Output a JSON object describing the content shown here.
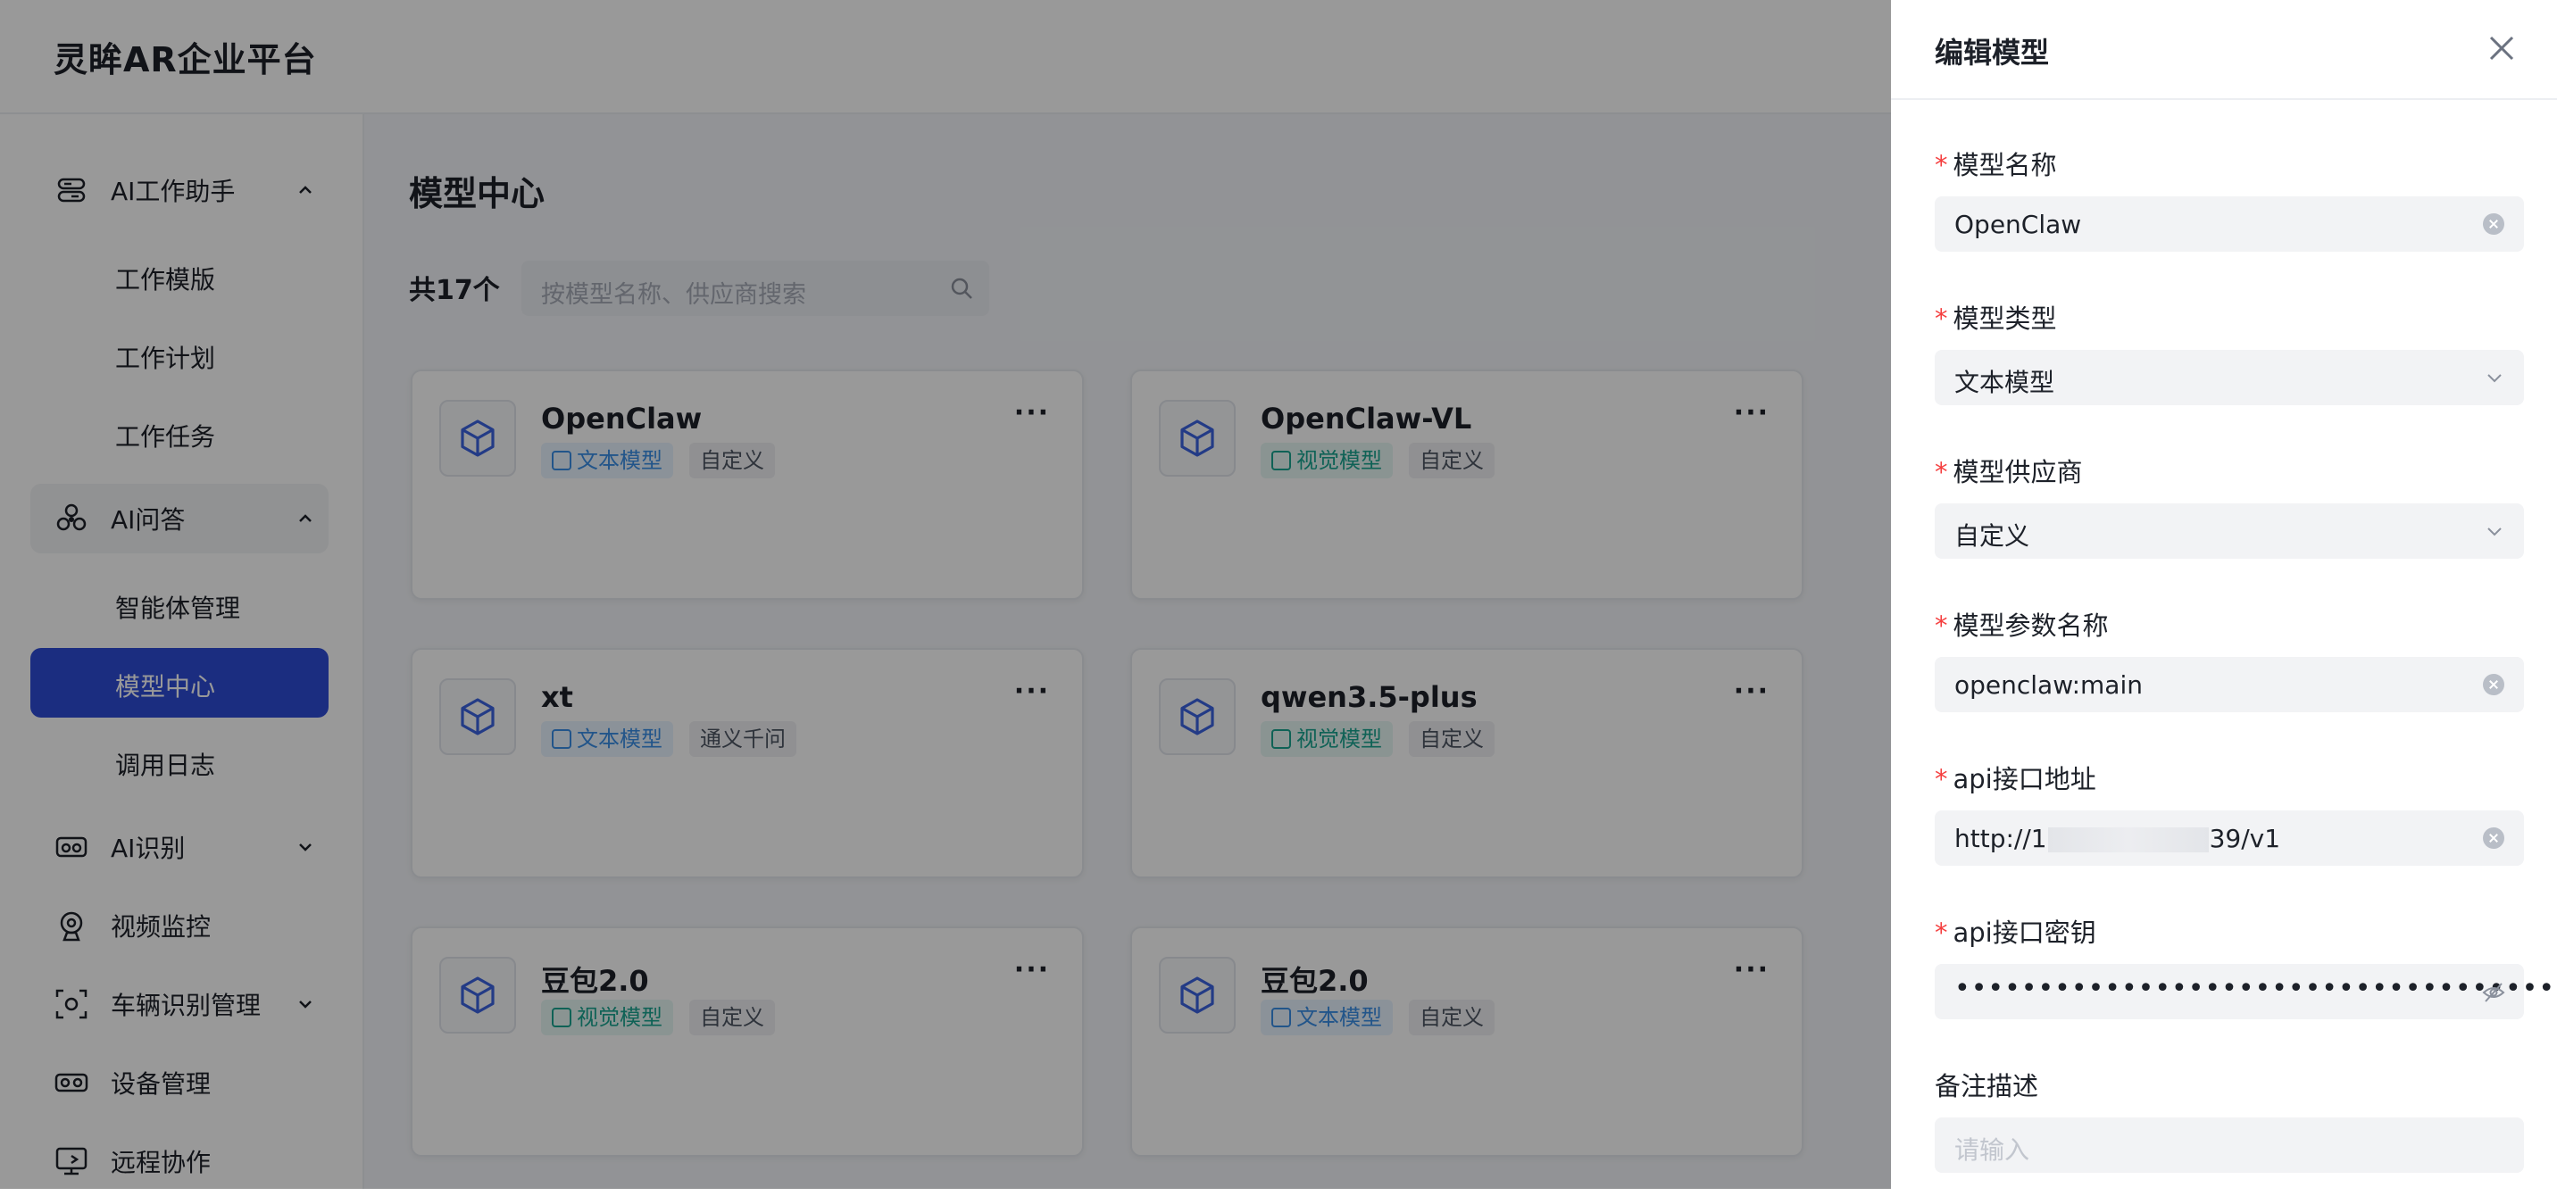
{
  "app": {
    "title": "灵眸AR企业平台"
  },
  "sidebar": {
    "groups": [
      {
        "label": "AI工作助手",
        "icon": "robot-assistant-icon",
        "expanded": true,
        "items": [
          {
            "label": "工作模版"
          },
          {
            "label": "工作计划"
          },
          {
            "label": "工作任务"
          }
        ]
      },
      {
        "label": "AI问答",
        "icon": "qa-chat-icon",
        "expanded": true,
        "items": [
          {
            "label": "智能体管理"
          },
          {
            "label": "模型中心",
            "active": true
          },
          {
            "label": "调用日志"
          }
        ]
      },
      {
        "label": "AI识别",
        "icon": "ai-vision-icon",
        "expanded": false
      },
      {
        "label": "视频监控",
        "icon": "camera-icon"
      },
      {
        "label": "车辆识别管理",
        "icon": "vehicle-scan-icon",
        "expanded": false
      },
      {
        "label": "设备管理",
        "icon": "ar-glasses-icon"
      },
      {
        "label": "远程协作",
        "icon": "remote-screen-icon"
      }
    ]
  },
  "main": {
    "title": "模型中心",
    "count": "共17个",
    "search_placeholder": "按模型名称、供应商搜索",
    "cards": [
      {
        "name": "OpenClaw",
        "type": "文本模型",
        "type_kind": "text",
        "vendor": "自定义"
      },
      {
        "name": "OpenClaw-VL",
        "type": "视觉模型",
        "type_kind": "vision",
        "vendor": "自定义"
      },
      {
        "name": "xt",
        "type": "文本模型",
        "type_kind": "text",
        "vendor": "通义千问"
      },
      {
        "name": "qwen3.5-plus",
        "type": "视觉模型",
        "type_kind": "vision",
        "vendor": "自定义"
      },
      {
        "name": "豆包2.0",
        "type": "视觉模型",
        "type_kind": "vision",
        "vendor": "自定义"
      },
      {
        "name": "豆包2.0",
        "type": "文本模型",
        "type_kind": "text",
        "vendor": "自定义"
      }
    ]
  },
  "drawer": {
    "title": "编辑模型",
    "fields": {
      "name": {
        "label": "模型名称",
        "value": "OpenClaw"
      },
      "type": {
        "label": "模型类型",
        "value": "文本模型"
      },
      "vendor": {
        "label": "模型供应商",
        "value": "自定义"
      },
      "param": {
        "label": "模型参数名称",
        "value": "openclaw:main"
      },
      "api_url": {
        "label": "api接口地址",
        "value_prefix": "http://1",
        "value_suffix": "39/v1"
      },
      "api_key": {
        "label": "api接口密钥",
        "masked": "••••••••••••••••••••••••••••••••••••••••••"
      },
      "remark": {
        "label": "备注描述",
        "placeholder": "请输入"
      }
    }
  },
  "colors": {
    "accent": "#2d4bd6",
    "required": "#f53f3f",
    "text_tag": "#3a8ee6",
    "vision_tag": "#1aa390"
  }
}
